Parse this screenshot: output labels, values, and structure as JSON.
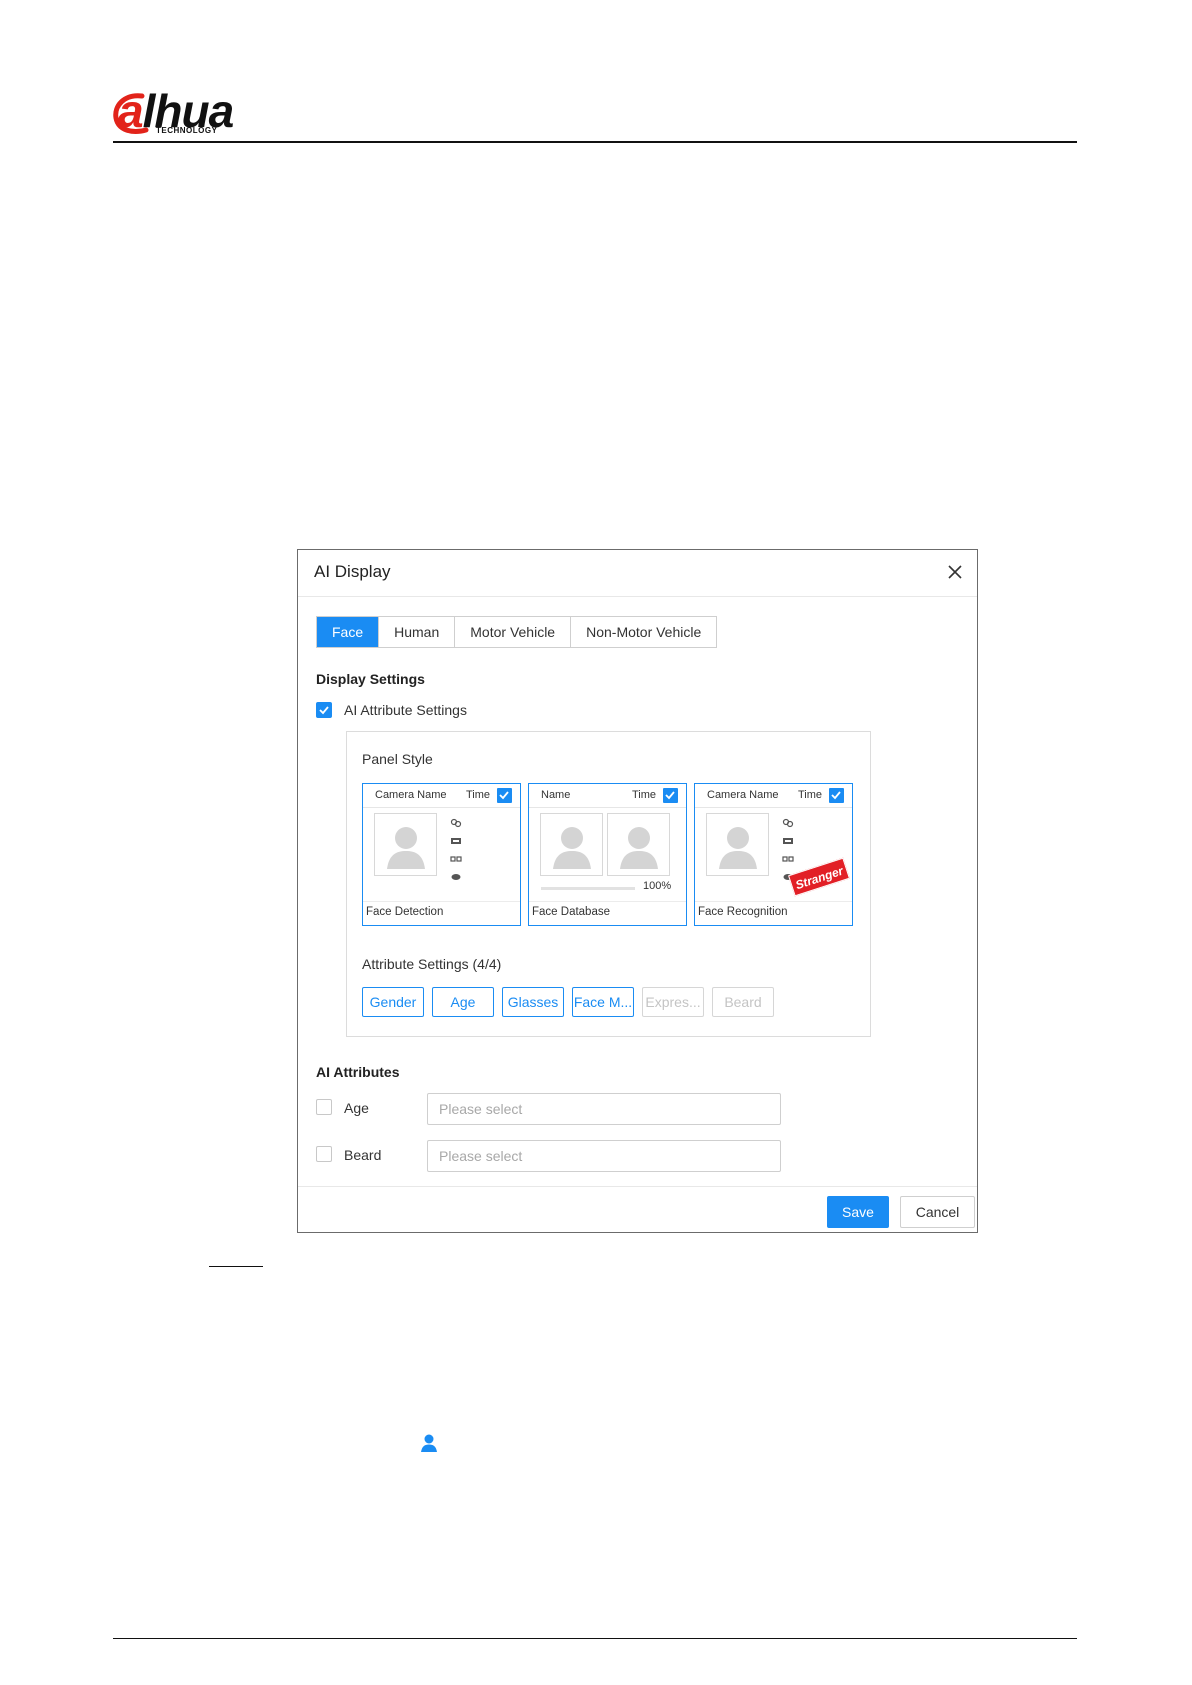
{
  "header": {
    "logo_main": "alhua",
    "logo_sub": "TECHNOLOGY"
  },
  "dialog": {
    "title": "AI Display",
    "tabs": [
      {
        "label": "Face",
        "active": true
      },
      {
        "label": "Human",
        "active": false
      },
      {
        "label": "Motor Vehicle",
        "active": false
      },
      {
        "label": "Non-Motor Vehicle",
        "active": false
      }
    ],
    "display_settings": {
      "title": "Display Settings",
      "ai_attribute_settings": {
        "label": "AI Attribute Settings",
        "checked": true
      },
      "panel_style": {
        "label": "Panel Style",
        "cards": [
          {
            "header_left": "Camera Name",
            "header_right": "Time",
            "checked": true,
            "footer": "Face Detection"
          },
          {
            "header_left": "Name",
            "header_right": "Time",
            "checked": true,
            "footer": "Face Database",
            "similarity": "100%",
            "similarity_fraction": 1.0
          },
          {
            "header_left": "Camera Name",
            "header_right": "Time",
            "checked": true,
            "footer": "Face Recognition",
            "stamp": "Stranger"
          }
        ]
      },
      "attribute_settings": {
        "label": "Attribute Settings (4/4)",
        "chips": [
          {
            "label": "Gender",
            "enabled": true
          },
          {
            "label": "Age",
            "enabled": true
          },
          {
            "label": "Glasses",
            "enabled": true
          },
          {
            "label": "Face M...",
            "enabled": true
          },
          {
            "label": "Expres...",
            "enabled": false
          },
          {
            "label": "Beard",
            "enabled": false
          }
        ]
      }
    },
    "ai_attributes": {
      "title": "AI Attributes",
      "rows": [
        {
          "label": "Age",
          "checked": false,
          "placeholder": "Please select"
        },
        {
          "label": "Beard",
          "checked": false,
          "placeholder": "Please select"
        }
      ]
    },
    "buttons": {
      "save": "Save",
      "cancel": "Cancel"
    }
  },
  "colors": {
    "accent": "#1a8cf3",
    "stranger": "#e21f26",
    "brand_red": "#e2231a"
  }
}
